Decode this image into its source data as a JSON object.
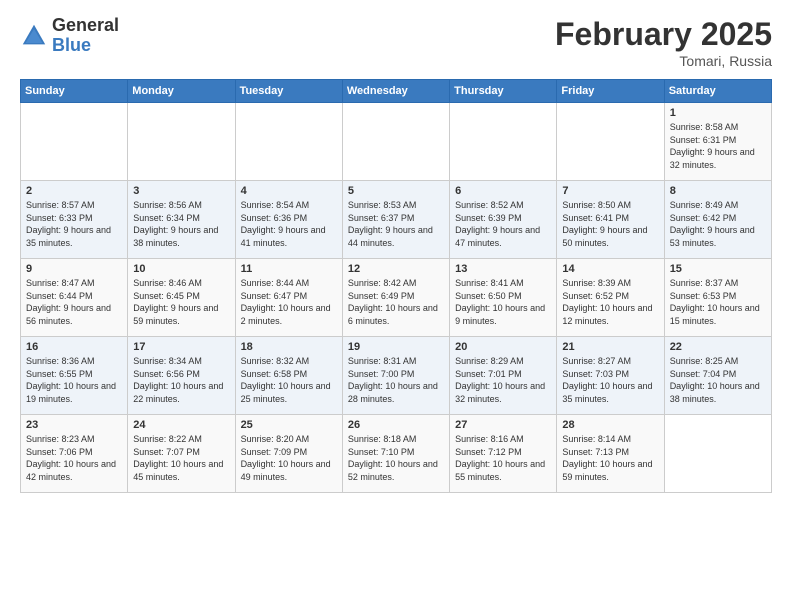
{
  "header": {
    "logo_general": "General",
    "logo_blue": "Blue",
    "month_title": "February 2025",
    "location": "Tomari, Russia"
  },
  "weekdays": [
    "Sunday",
    "Monday",
    "Tuesday",
    "Wednesday",
    "Thursday",
    "Friday",
    "Saturday"
  ],
  "weeks": [
    [
      {
        "day": "",
        "info": ""
      },
      {
        "day": "",
        "info": ""
      },
      {
        "day": "",
        "info": ""
      },
      {
        "day": "",
        "info": ""
      },
      {
        "day": "",
        "info": ""
      },
      {
        "day": "",
        "info": ""
      },
      {
        "day": "1",
        "info": "Sunrise: 8:58 AM\nSunset: 6:31 PM\nDaylight: 9 hours and 32 minutes."
      }
    ],
    [
      {
        "day": "2",
        "info": "Sunrise: 8:57 AM\nSunset: 6:33 PM\nDaylight: 9 hours and 35 minutes."
      },
      {
        "day": "3",
        "info": "Sunrise: 8:56 AM\nSunset: 6:34 PM\nDaylight: 9 hours and 38 minutes."
      },
      {
        "day": "4",
        "info": "Sunrise: 8:54 AM\nSunset: 6:36 PM\nDaylight: 9 hours and 41 minutes."
      },
      {
        "day": "5",
        "info": "Sunrise: 8:53 AM\nSunset: 6:37 PM\nDaylight: 9 hours and 44 minutes."
      },
      {
        "day": "6",
        "info": "Sunrise: 8:52 AM\nSunset: 6:39 PM\nDaylight: 9 hours and 47 minutes."
      },
      {
        "day": "7",
        "info": "Sunrise: 8:50 AM\nSunset: 6:41 PM\nDaylight: 9 hours and 50 minutes."
      },
      {
        "day": "8",
        "info": "Sunrise: 8:49 AM\nSunset: 6:42 PM\nDaylight: 9 hours and 53 minutes."
      }
    ],
    [
      {
        "day": "9",
        "info": "Sunrise: 8:47 AM\nSunset: 6:44 PM\nDaylight: 9 hours and 56 minutes."
      },
      {
        "day": "10",
        "info": "Sunrise: 8:46 AM\nSunset: 6:45 PM\nDaylight: 9 hours and 59 minutes."
      },
      {
        "day": "11",
        "info": "Sunrise: 8:44 AM\nSunset: 6:47 PM\nDaylight: 10 hours and 2 minutes."
      },
      {
        "day": "12",
        "info": "Sunrise: 8:42 AM\nSunset: 6:49 PM\nDaylight: 10 hours and 6 minutes."
      },
      {
        "day": "13",
        "info": "Sunrise: 8:41 AM\nSunset: 6:50 PM\nDaylight: 10 hours and 9 minutes."
      },
      {
        "day": "14",
        "info": "Sunrise: 8:39 AM\nSunset: 6:52 PM\nDaylight: 10 hours and 12 minutes."
      },
      {
        "day": "15",
        "info": "Sunrise: 8:37 AM\nSunset: 6:53 PM\nDaylight: 10 hours and 15 minutes."
      }
    ],
    [
      {
        "day": "16",
        "info": "Sunrise: 8:36 AM\nSunset: 6:55 PM\nDaylight: 10 hours and 19 minutes."
      },
      {
        "day": "17",
        "info": "Sunrise: 8:34 AM\nSunset: 6:56 PM\nDaylight: 10 hours and 22 minutes."
      },
      {
        "day": "18",
        "info": "Sunrise: 8:32 AM\nSunset: 6:58 PM\nDaylight: 10 hours and 25 minutes."
      },
      {
        "day": "19",
        "info": "Sunrise: 8:31 AM\nSunset: 7:00 PM\nDaylight: 10 hours and 28 minutes."
      },
      {
        "day": "20",
        "info": "Sunrise: 8:29 AM\nSunset: 7:01 PM\nDaylight: 10 hours and 32 minutes."
      },
      {
        "day": "21",
        "info": "Sunrise: 8:27 AM\nSunset: 7:03 PM\nDaylight: 10 hours and 35 minutes."
      },
      {
        "day": "22",
        "info": "Sunrise: 8:25 AM\nSunset: 7:04 PM\nDaylight: 10 hours and 38 minutes."
      }
    ],
    [
      {
        "day": "23",
        "info": "Sunrise: 8:23 AM\nSunset: 7:06 PM\nDaylight: 10 hours and 42 minutes."
      },
      {
        "day": "24",
        "info": "Sunrise: 8:22 AM\nSunset: 7:07 PM\nDaylight: 10 hours and 45 minutes."
      },
      {
        "day": "25",
        "info": "Sunrise: 8:20 AM\nSunset: 7:09 PM\nDaylight: 10 hours and 49 minutes."
      },
      {
        "day": "26",
        "info": "Sunrise: 8:18 AM\nSunset: 7:10 PM\nDaylight: 10 hours and 52 minutes."
      },
      {
        "day": "27",
        "info": "Sunrise: 8:16 AM\nSunset: 7:12 PM\nDaylight: 10 hours and 55 minutes."
      },
      {
        "day": "28",
        "info": "Sunrise: 8:14 AM\nSunset: 7:13 PM\nDaylight: 10 hours and 59 minutes."
      },
      {
        "day": "",
        "info": ""
      }
    ]
  ]
}
